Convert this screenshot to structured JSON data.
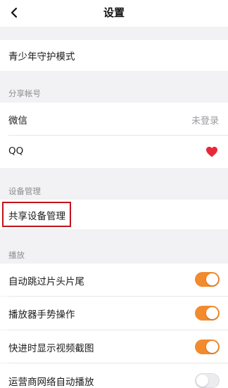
{
  "header": {
    "title": "设置",
    "back_icon": "chevron-left-icon"
  },
  "youth_mode": {
    "label": "青少年守护模式"
  },
  "share_account": {
    "section_title": "分享帐号",
    "wechat": {
      "label": "微信",
      "status": "未登录"
    },
    "qq": {
      "label": "QQ",
      "status_icon": "heart-icon"
    }
  },
  "device_management": {
    "section_title": "设备管理",
    "shared_devices": {
      "label": "共享设备管理"
    }
  },
  "playback": {
    "section_title": "播放",
    "items": [
      {
        "label": "自动跳过片头片尾",
        "enabled": true
      },
      {
        "label": "播放器手势操作",
        "enabled": true
      },
      {
        "label": "快进时显示视频截图",
        "enabled": true
      },
      {
        "label": "运营商网络自动播放",
        "enabled": false
      }
    ]
  },
  "colors": {
    "toggle_on": "#f28a2e",
    "highlight_border": "#c0141a",
    "heart": "#e8283a"
  }
}
